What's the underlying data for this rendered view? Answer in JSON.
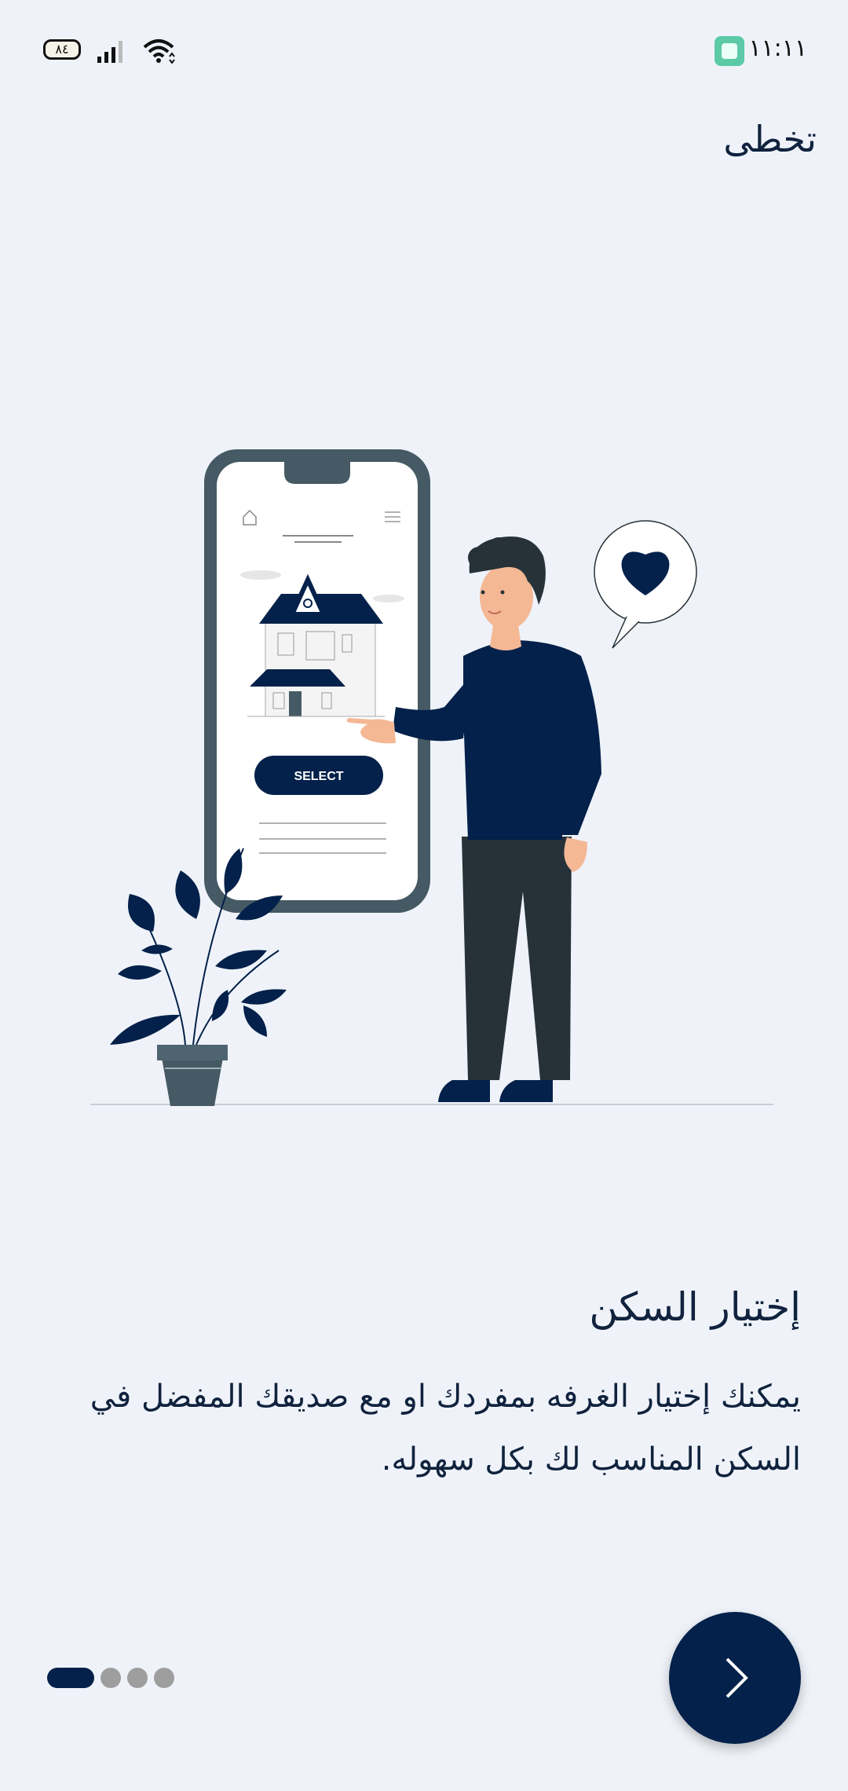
{
  "status_bar": {
    "time": "١١:١١",
    "battery_level": "٨٤",
    "icons": [
      "battery-icon",
      "signal-icon",
      "wifi-icon",
      "app-notification-icon"
    ]
  },
  "header": {
    "skip_label": "تخطى"
  },
  "illustration": {
    "select_button_label": "SELECT",
    "icons": [
      "phone-illustration",
      "house-illustration",
      "person-illustration",
      "heart-speech-bubble",
      "plant-illustration"
    ]
  },
  "content": {
    "title": "إختيار السكن",
    "description": "يمكنك إختيار الغرفه بمفردك او مع صديقك المفضل في السكن المناسب لك بكل سهوله."
  },
  "pager": {
    "total_pages": 4,
    "current_page": 1
  },
  "colors": {
    "background": "#eff3f9",
    "primary": "#03214a",
    "inactive_dot": "#9e9e9e"
  },
  "next_button": {
    "icon": "chevron-right-icon"
  }
}
